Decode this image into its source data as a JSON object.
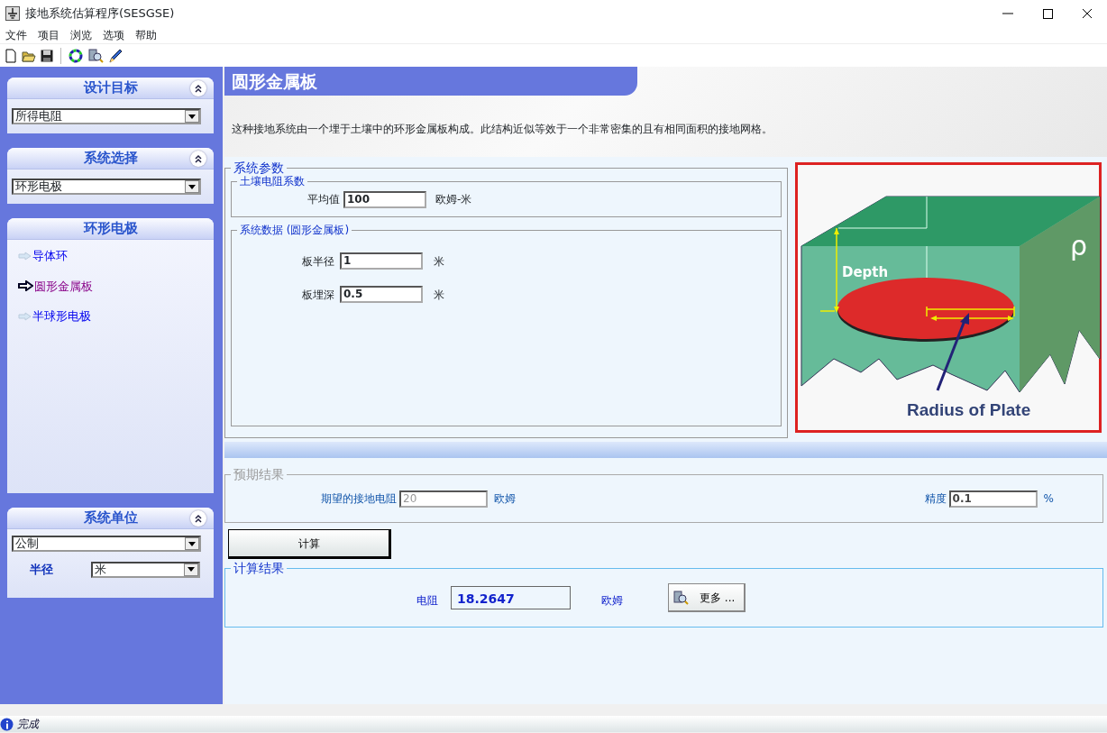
{
  "window": {
    "title": "接地系统估算程序(SESGSE)"
  },
  "menu": [
    "文件",
    "项目",
    "浏览",
    "选项",
    "帮助"
  ],
  "sidebar": {
    "design_goal": {
      "title": "设计目标",
      "value": "所得电阻"
    },
    "system_select": {
      "title": "系统选择",
      "value": "环形电极"
    },
    "electrodes": {
      "title": "环形电极",
      "items": [
        {
          "label": "导体环",
          "selected": false
        },
        {
          "label": "圆形金属板",
          "selected": true
        },
        {
          "label": "半球形电极",
          "selected": false
        }
      ]
    },
    "units": {
      "title": "系统单位",
      "value": "公制",
      "radius_label": "半径",
      "radius_value": "米"
    }
  },
  "page": {
    "title": "圆形金属板",
    "description": "这种接地系统由一个埋于土壤中的环形金属板构成。此结构近似等效于一个非常密集的且有相同面积的接地网格。"
  },
  "system_params": {
    "title": "系统参数",
    "soil": {
      "title": "土壤电阻系数",
      "label": "平均值",
      "value": "100",
      "unit": "欧姆-米"
    },
    "data": {
      "title": "系统数据 (圆形金属板)",
      "fields": [
        {
          "label": "板半径",
          "value": "1",
          "unit": "米"
        },
        {
          "label": "板埋深",
          "value": "0.5",
          "unit": "米"
        }
      ]
    }
  },
  "diagram": {
    "depth_label": "Depth",
    "rho_label": "ρ",
    "radius_label": "Radius of Plate"
  },
  "expected": {
    "title": "预期结果",
    "fields": [
      {
        "label": "期望的接地电阻",
        "value": "20",
        "unit": "欧姆",
        "disabled": true
      },
      {
        "label": "精度",
        "value": "0.1",
        "unit": "%",
        "disabled": false
      }
    ]
  },
  "calc_button": "计算",
  "result": {
    "title": "计算结果",
    "label": "电阻",
    "value": "18.2647",
    "unit": "欧姆",
    "more_button": "更多 ..."
  },
  "status_bar": {
    "text": "完成"
  }
}
